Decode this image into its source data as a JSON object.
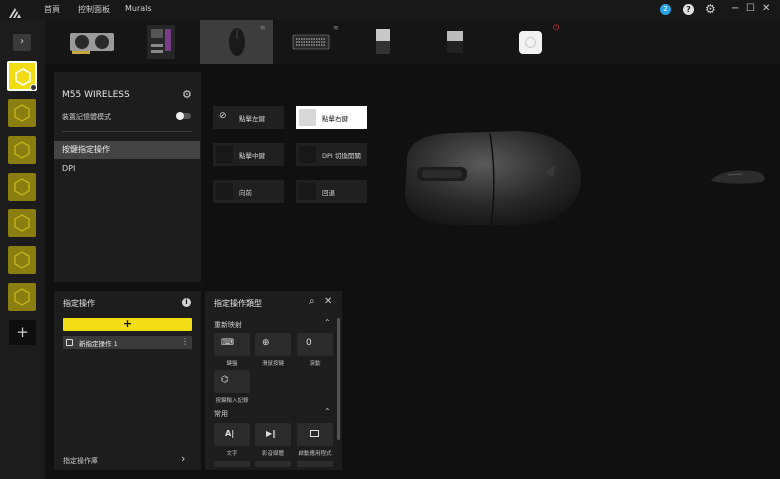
{
  "nav": {
    "home": "首頁",
    "dashboard": "控制面板",
    "murals": "Murals"
  },
  "notifications": {
    "count": "2"
  },
  "device": {
    "name": "M55 WIRELESS",
    "memory_mode": "裝置記憶體模式"
  },
  "menu": {
    "key_assignment": "按鍵指定操作",
    "dpi": "DPI"
  },
  "buttons": {
    "left_click": "點擊左鍵",
    "right_click": "點擊右鍵",
    "middle_click": "點擊中鍵",
    "dpi_toggle": "DPI 切換開關",
    "forward": "向前",
    "back": "回退"
  },
  "actions": {
    "title": "指定操作",
    "new_action": "新指定操作 1",
    "library": "指定操作庫"
  },
  "types": {
    "title": "指定操作類型",
    "remap": "重新映射",
    "common": "常用",
    "keyboard": "鍵盤",
    "mouse": "滑鼠按鍵",
    "scroll": "滾動",
    "key_record": "按鍵輸入記錄",
    "text": "文字",
    "media": "影音媒體",
    "launch": "啟動應用程式"
  },
  "colors": {
    "accent": "#f2dc13",
    "selected": "#444444",
    "background": "#101010"
  }
}
